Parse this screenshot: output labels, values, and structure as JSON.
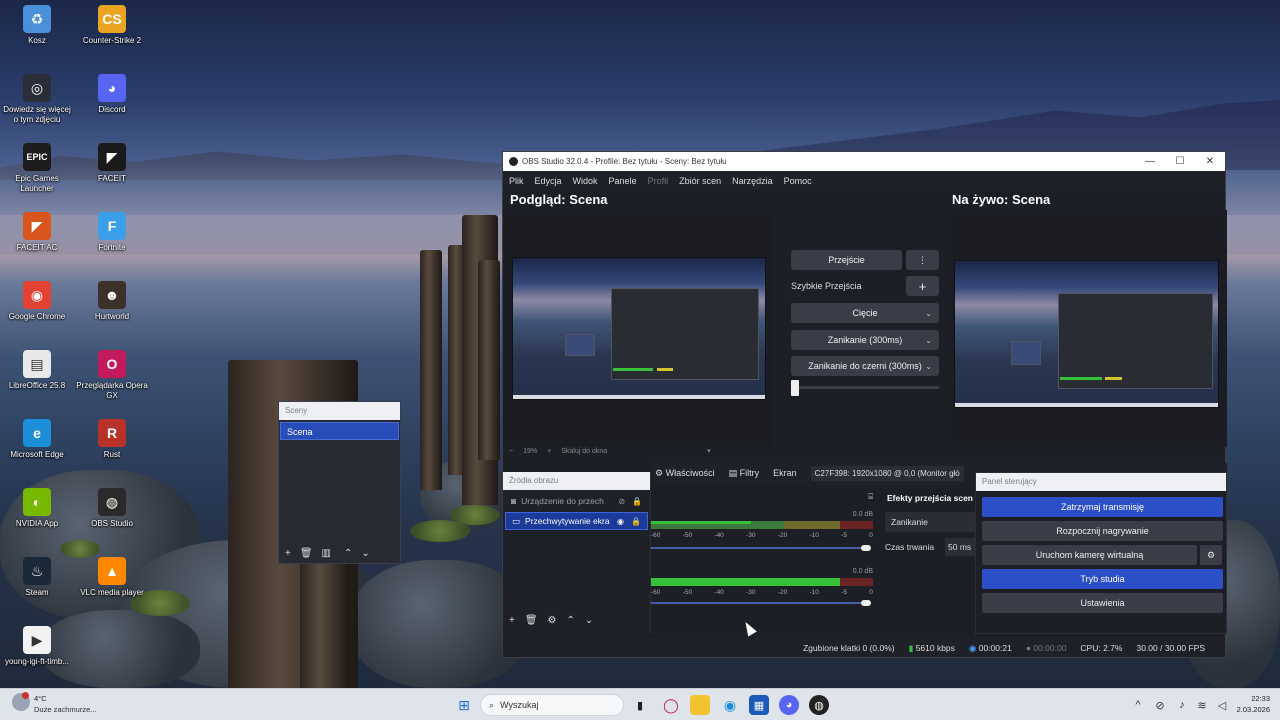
{
  "desktop": {
    "icons": [
      {
        "label": "Kosz",
        "icon": "recycle-bin-icon",
        "color": "#4a90d9",
        "glyph": "♻"
      },
      {
        "label": "Counter-Strike 2",
        "icon": "cs2-icon",
        "color": "#e8a422",
        "glyph": "CS"
      },
      {
        "label": "Dowiedz się więcej o tym zdjęciu",
        "icon": "camera-info-icon",
        "color": "#2a2e38",
        "glyph": "◎"
      },
      {
        "label": "Discord",
        "icon": "discord-icon",
        "color": "#5865f2",
        "glyph": "◕"
      },
      {
        "label": "Epic Games Launcher",
        "icon": "epic-games-icon",
        "color": "#1d1d1d",
        "glyph": "EPIC"
      },
      {
        "label": "FACEIT",
        "icon": "faceit-icon",
        "color": "#1a1a1a",
        "glyph": "◤"
      },
      {
        "label": "FACEIT AC",
        "icon": "faceit-ac-icon",
        "color": "#d9551e",
        "glyph": "◤"
      },
      {
        "label": "Fortnite",
        "icon": "fortnite-icon",
        "color": "#3b9ee8",
        "glyph": "F"
      },
      {
        "label": "Google Chrome",
        "icon": "chrome-icon",
        "color": "#e34133",
        "glyph": "◉"
      },
      {
        "label": "Hurtworld",
        "icon": "hurtworld-icon",
        "color": "#3b3126",
        "glyph": "☻"
      },
      {
        "label": "LibreOffice 25.8",
        "icon": "libreoffice-icon",
        "color": "#e8e8e8",
        "glyph": "▤"
      },
      {
        "label": "Przeglądarka Opera GX",
        "icon": "opera-gx-icon",
        "color": "#c21a5a",
        "glyph": "O"
      },
      {
        "label": "Microsoft Edge",
        "icon": "edge-icon",
        "color": "#1c8fd8",
        "glyph": "e"
      },
      {
        "label": "Rust",
        "icon": "rust-icon",
        "color": "#b8322a",
        "glyph": "R"
      },
      {
        "label": "NVIDIA App",
        "icon": "nvidia-icon",
        "color": "#76b900",
        "glyph": "◐"
      },
      {
        "label": "OBS Studio",
        "icon": "obs-studio-icon",
        "color": "#2b2b2b",
        "glyph": "◍"
      },
      {
        "label": "Steam",
        "icon": "steam-icon",
        "color": "#1b2838",
        "glyph": "♨"
      },
      {
        "label": "VLC media player",
        "icon": "vlc-icon",
        "color": "#ff8800",
        "glyph": "▲"
      },
      {
        "label": "young-igi-ft-timb...",
        "icon": "video-file-icon",
        "color": "#f2f2f2",
        "glyph": "▶"
      }
    ]
  },
  "scenes_dock": {
    "title": "Sceny",
    "scene": "Scena"
  },
  "obs": {
    "title": "OBS Studio 32.0.4 - Profile: Bez tytułu - Sceny: Bez tytułu",
    "menu": [
      "Plik",
      "Edycja",
      "Widok",
      "Panele",
      "Profil",
      "Zbiór scen",
      "Narzędzia",
      "Pomoc"
    ],
    "preview_heading": "Podgląd: Scena",
    "live_heading": "Na żywo: Scena",
    "transition_button": "Przejście",
    "quick_transitions": "Szybkie Przejścia",
    "cut": "Cięcie",
    "fade": "Zanikanie (300ms)",
    "fade_black": "Zanikanie do czerni (300ms)",
    "zoom_minus": "−",
    "zoom_value": "19%",
    "zoom_plus": "+",
    "zoom_fit": "Skaluj do okna",
    "ctx_properties": "Właściwości",
    "ctx_filters": "Filtry",
    "ctx_screen": "Ekran",
    "ctx_monitor": "C27F398: 1920x1080 @ 0,0 (Monitor głó",
    "sources_title": "Źródła obrazu",
    "source_1": "Urządzenie do przech",
    "source_2": "Przechwytywanie ekra",
    "meter1_db": "0.0 dB",
    "meter2_db": "0.0 dB",
    "ticks": [
      "-60",
      "-50",
      "-40",
      "-30",
      "-20",
      "-10",
      "-5",
      "0"
    ],
    "meter1_level": 0.45,
    "meter2_level": 0.85,
    "trans_title": "Efekty przejścia scen",
    "trans_type": "Zanikanie",
    "duration_label": "Czas trwania",
    "duration_value": "50 ms",
    "control_title": "Panel sterujący",
    "ctrl_stop_stream": "Zatrzymaj transmisję",
    "ctrl_record": "Rozpocznij nagrywanie",
    "ctrl_virtualcam": "Uruchom kamerę wirtualną",
    "ctrl_studio": "Tryb studia",
    "ctrl_settings": "Ustawienia",
    "status_dropped": "Zgubione klatki 0 (0.0%)",
    "status_kbps": "5610 kbps",
    "status_stream_time": "00:00:21",
    "status_rec_time": "00:00:00",
    "status_cpu": "CPU: 2.7%",
    "status_fps": "30.00 / 30.00 FPS"
  },
  "taskbar": {
    "weather_temp": "4°C",
    "weather_desc": "Duże zachmurze...",
    "search_placeholder": "Wyszukaj",
    "time": "22:33",
    "date": "2.03.2026"
  }
}
